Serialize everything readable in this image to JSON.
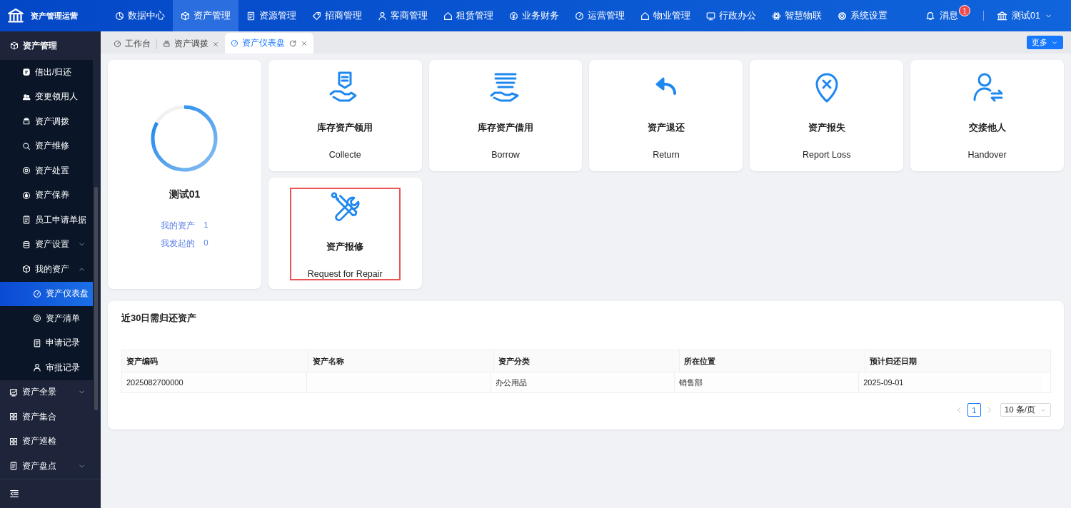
{
  "app": {
    "title": "资产管理运营"
  },
  "top_nav": {
    "items": [
      {
        "label": "数据中心",
        "selected": false
      },
      {
        "label": "资产管理",
        "selected": true
      },
      {
        "label": "资源管理",
        "selected": false
      },
      {
        "label": "招商管理",
        "selected": false
      },
      {
        "label": "客商管理",
        "selected": false
      },
      {
        "label": "租赁管理",
        "selected": false
      },
      {
        "label": "业务财务",
        "selected": false
      },
      {
        "label": "运营管理",
        "selected": false
      },
      {
        "label": "物业管理",
        "selected": false
      },
      {
        "label": "行政办公",
        "selected": false
      },
      {
        "label": "智慧物联",
        "selected": false
      },
      {
        "label": "系统设置",
        "selected": false
      }
    ],
    "messages": {
      "label": "消息",
      "badge": "1"
    },
    "user": "测试01"
  },
  "sidebar": {
    "items": [
      {
        "label": "资产管理",
        "selected": false,
        "children": [
          {
            "label": "借出/归还",
            "selected": false
          },
          {
            "label": "变更领用人",
            "selected": false
          },
          {
            "label": "资产调拨",
            "selected": false
          },
          {
            "label": "资产维修",
            "selected": false
          },
          {
            "label": "资产处置",
            "selected": false
          },
          {
            "label": "资产保养",
            "selected": false
          },
          {
            "label": "员工申请单据",
            "selected": false
          },
          {
            "label": "资产设置",
            "selected": false,
            "expanded": false
          },
          {
            "label": "我的资产",
            "selected": false,
            "expanded": true,
            "children": [
              {
                "label": "资产仪表盘",
                "selected": true
              },
              {
                "label": "资产清单",
                "selected": false
              },
              {
                "label": "申请记录",
                "selected": false
              },
              {
                "label": "审批记录",
                "selected": false
              }
            ]
          }
        ]
      },
      {
        "label": "资产全景",
        "selected": false,
        "expanded": false
      },
      {
        "label": "资产集合",
        "selected": false
      },
      {
        "label": "资产巡检",
        "selected": false
      },
      {
        "label": "资产盘点",
        "selected": false,
        "expanded": false
      }
    ]
  },
  "tabs": [
    {
      "label": "工作台",
      "selected": false,
      "closable": false
    },
    {
      "label": "资产调拨",
      "selected": false,
      "closable": true
    },
    {
      "label": "资产仪表盘",
      "selected": true,
      "closable": true
    }
  ],
  "more_button": "更多",
  "profile": {
    "name": "测试01",
    "stats": [
      {
        "label": "我的资产",
        "value": "1"
      },
      {
        "label": "我发起的",
        "value": "0"
      }
    ]
  },
  "actions": [
    {
      "title": "库存资产领用",
      "subtitle": "Collecte",
      "highlighted": false
    },
    {
      "title": "库存资产借用",
      "subtitle": "Borrow",
      "highlighted": false
    },
    {
      "title": "资产退还",
      "subtitle": "Return",
      "highlighted": false
    },
    {
      "title": "资产报失",
      "subtitle": "Report Loss",
      "highlighted": false
    },
    {
      "title": "交接他人",
      "subtitle": "Handover",
      "highlighted": false
    },
    {
      "title": "资产报修",
      "subtitle": "Request for Repair",
      "highlighted": true
    }
  ],
  "returns": {
    "title": "近30日需归还资产",
    "columns": [
      "资产编码",
      "资产名称",
      "资产分类",
      "所在位置",
      "预计归还日期"
    ],
    "rows": [
      [
        "2025082700000",
        null,
        "办公用品",
        "销售部",
        "2025-09-01"
      ]
    ],
    "pagination": {
      "pages": [
        {
          "label": "1",
          "selected": true
        }
      ],
      "page_size": "10 条/页"
    }
  }
}
